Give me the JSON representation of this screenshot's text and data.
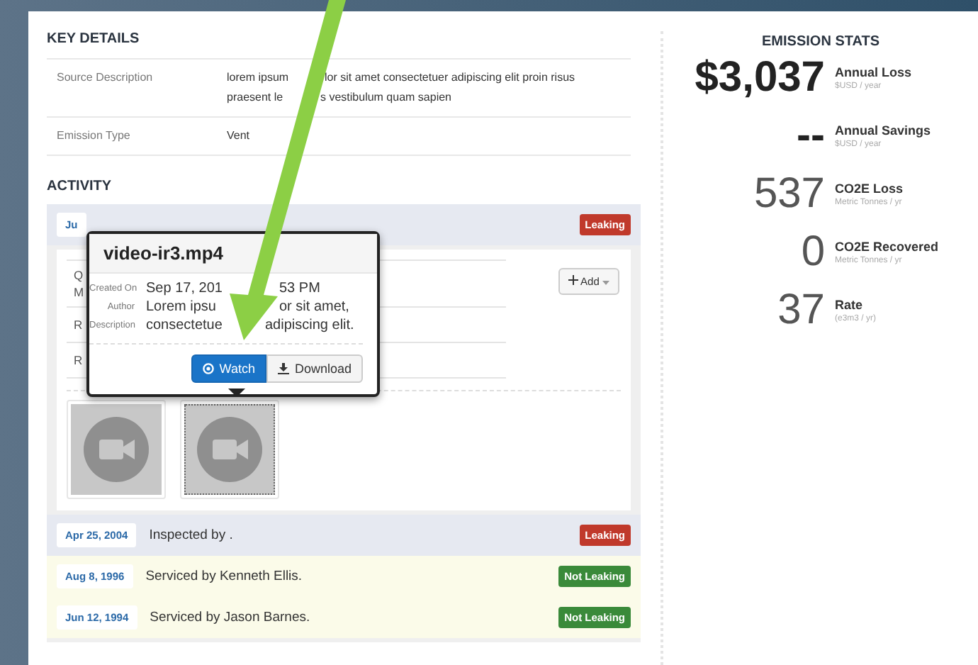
{
  "key_details": {
    "title": "KEY DETAILS",
    "rows": [
      {
        "label": "Source Description",
        "lines": [
          [
            "lorem ipsum",
            "lor sit amet consectetuer adipiscing elit proin risus"
          ],
          [
            "praesent le",
            "s vestibulum quam sapien"
          ]
        ]
      },
      {
        "label": "Emission Type",
        "lines": [
          [
            "Vent"
          ]
        ]
      }
    ]
  },
  "activity": {
    "title": "ACTIVITY",
    "items": [
      {
        "kind": "inspection",
        "date": "Ju",
        "status": {
          "kind": "leaking",
          "label": "Leaking"
        },
        "expanded": true,
        "details": [
          {
            "lines": [
              "Q",
              "M"
            ]
          },
          {
            "lines": [
              "R"
            ]
          },
          {
            "lines": [
              "R"
            ]
          }
        ],
        "add_button": "Add",
        "videos": [
          {
            "selected": false
          },
          {
            "selected": true
          }
        ]
      },
      {
        "kind": "inspection",
        "date": "Apr 25, 2004",
        "text": "Inspected by .",
        "status": {
          "kind": "leaking",
          "label": "Leaking"
        },
        "expanded": false
      },
      {
        "kind": "service",
        "date": "Aug 8, 1996",
        "text": "Serviced by Kenneth Ellis.",
        "status": {
          "kind": "not_leaking",
          "label": "Not Leaking"
        },
        "expanded": false
      },
      {
        "kind": "service",
        "date": "Jun 12, 1994",
        "text": "Serviced by Jason Barnes.",
        "status": {
          "kind": "not_leaking",
          "label": "Not Leaking"
        },
        "expanded": false
      }
    ]
  },
  "popover": {
    "title": "video-ir3.mp4",
    "fields": [
      {
        "label": "Created On",
        "parts": [
          "Sep 17, 201",
          "53 PM"
        ]
      },
      {
        "label": "Author",
        "parts": [
          "Lorem ipsu",
          "or sit amet,"
        ]
      },
      {
        "label": "Description",
        "parts": [
          "consectetue",
          "adipiscing elit."
        ]
      }
    ],
    "buttons": [
      {
        "label": "Watch",
        "kind": "primary"
      },
      {
        "label": "Download",
        "kind": "default"
      }
    ]
  },
  "emission_stats": {
    "title": "EMISSION STATS",
    "items": [
      {
        "kind": "emphasis",
        "value": "$3,037",
        "label": "Annual Loss",
        "unit": "$USD / year"
      },
      {
        "kind": "emphasis",
        "value": "--",
        "label": "Annual Savings",
        "unit": "$USD / year"
      },
      {
        "kind": "plain",
        "value": "537",
        "label": "CO2E Loss",
        "unit": "Metric Tonnes / yr"
      },
      {
        "kind": "plain",
        "value": "0",
        "label": "CO2E Recovered",
        "unit": "Metric Tonnes / yr"
      },
      {
        "kind": "plain",
        "value": "37",
        "label": "Rate",
        "unit": "(e3m3 / yr)"
      }
    ]
  }
}
